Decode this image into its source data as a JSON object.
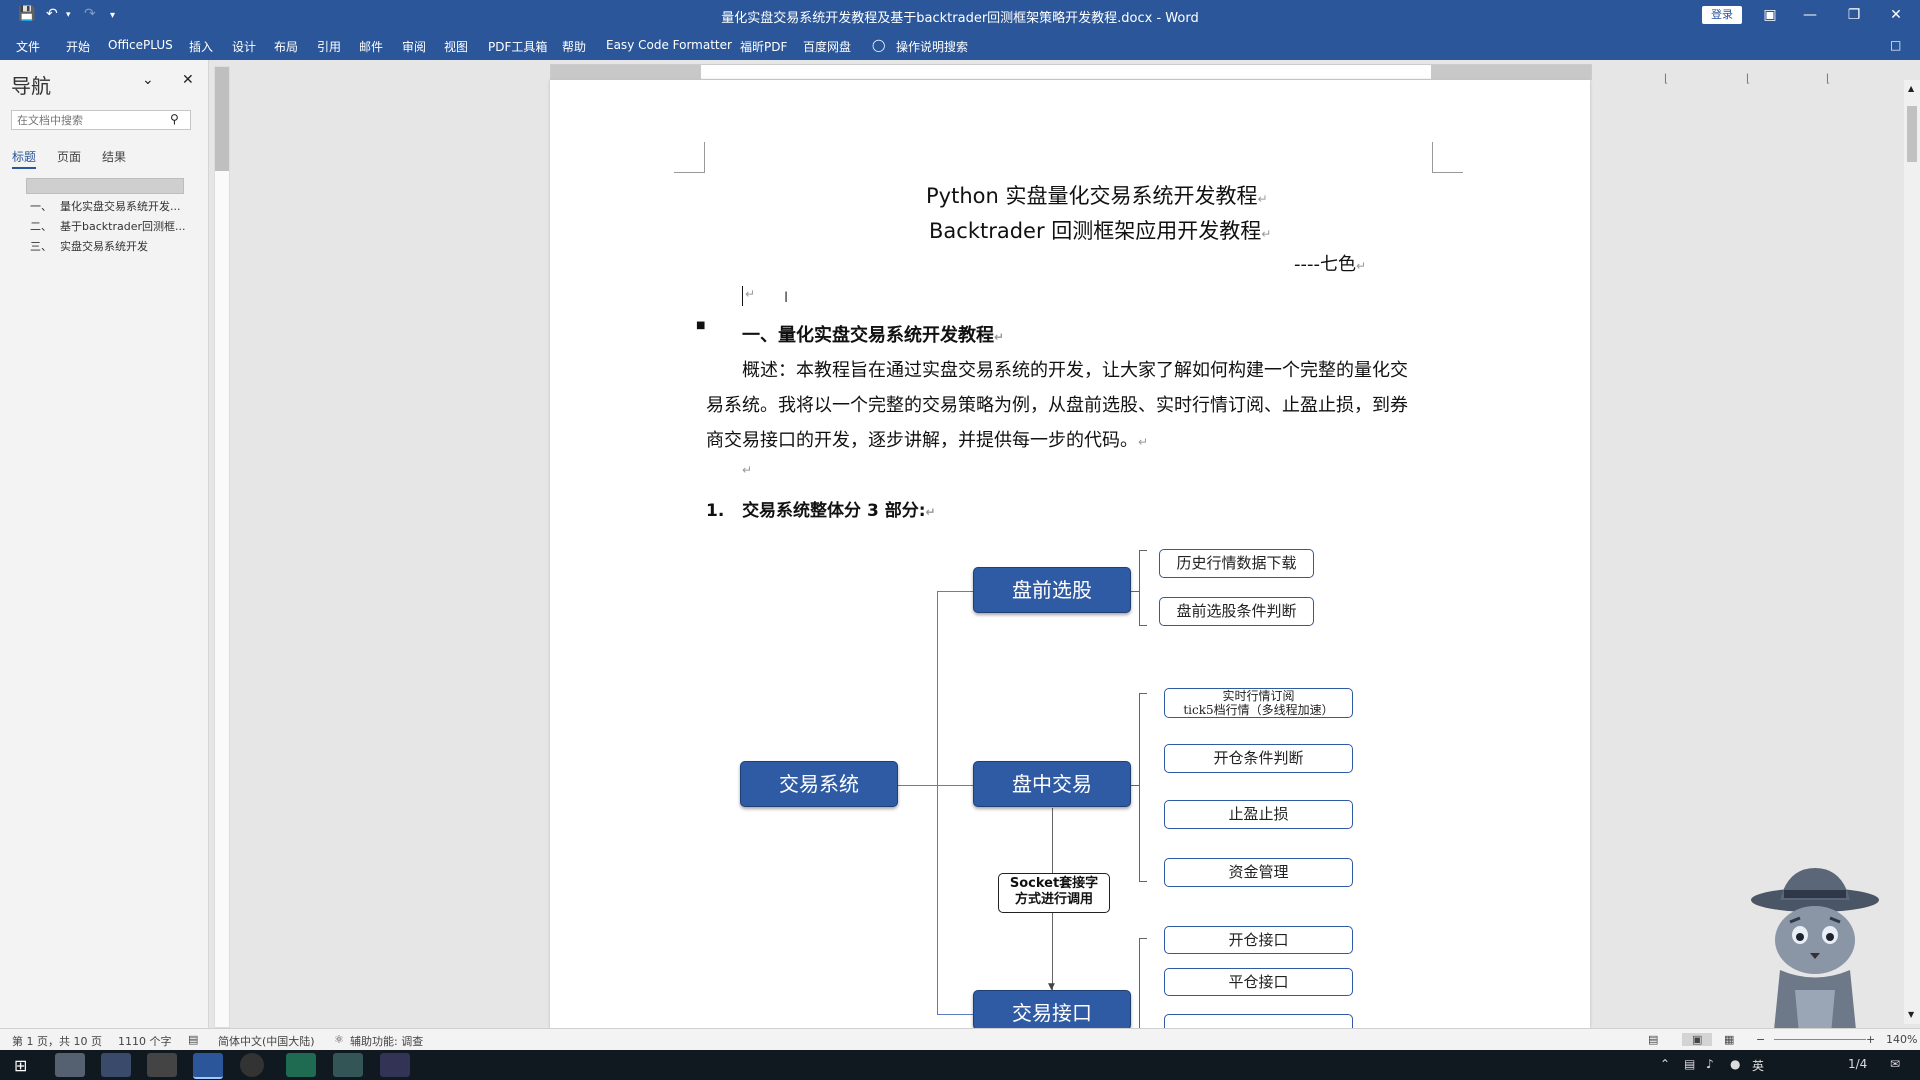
{
  "window": {
    "title": "量化实盘交易系统开发教程及基于backtrader回测框架策略开发教程.docx - Word",
    "login_label": "登录"
  },
  "menu": [
    "文件",
    "开始",
    "OfficePLUS",
    "插入",
    "设计",
    "布局",
    "引用",
    "邮件",
    "审阅",
    "视图",
    "PDF工具箱",
    "帮助",
    "Easy Code Formatter",
    "福昕PDF",
    "百度网盘",
    "操作说明搜索"
  ],
  "nav": {
    "title": "导航",
    "search_placeholder": "在文档中搜索",
    "tabs": [
      "标题",
      "页面",
      "结果"
    ],
    "items": [
      {
        "num": "一、",
        "label": "量化实盘交易系统开发..."
      },
      {
        "num": "二、",
        "label": "基于backtrader回测框..."
      },
      {
        "num": "三、",
        "label": "实盘交易系统开发"
      }
    ]
  },
  "document": {
    "title_line1": "Python 实盘量化交易系统开发教程",
    "title_line2": "Backtrader 回测框架应用开发教程",
    "author": "----七色",
    "section1_heading": "一、量化实盘交易系统开发教程",
    "overview_line1": "概述：本教程旨在通过实盘交易系统的开发，让大家了解如何构建一个完整的量化交",
    "overview_line2": "易系统。我将以一个完整的交易策略为例，从盘前选股、实时行情订阅、止盈止损，到券",
    "overview_line3": "商交易接口的开发，逐步讲解，并提供每一步的代码。",
    "list1_num": "1.",
    "list1_text": "交易系统整体分 3 部分:",
    "para_mark": "↵"
  },
  "diagram": {
    "root": "交易系统",
    "pre_market": "盘前选股",
    "intraday": "盘中交易",
    "broker_api": "交易接口",
    "socket_line1": "Socket套接字",
    "socket_line2": "方式进行调用",
    "pre_leaves": [
      "历史行情数据下载",
      "盘前选股条件判断"
    ],
    "intra_leaf1_line1": "实时行情订阅",
    "intra_leaf1_line2": "tick5档行情（多线程加速）",
    "intra_leaves": [
      "开仓条件判断",
      "止盈止损",
      "资金管理"
    ],
    "api_leaves": [
      "开仓接口",
      "平仓接口"
    ]
  },
  "status": {
    "page": "第 1 页，共 10 页",
    "words": "1110 个字",
    "lang": "简体中文(中国大陆)",
    "accessibility": "辅助功能: 调查",
    "zoom": "140%"
  },
  "taskbar": {
    "ime": "英",
    "page_counter": "1/4"
  },
  "colors": {
    "title_bar": "#2b579a",
    "node_fill": "#2f5ba5"
  }
}
